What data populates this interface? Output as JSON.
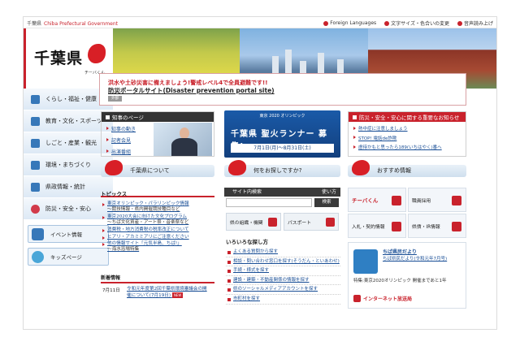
{
  "topbar": {
    "prefecture": "千葉県",
    "english": "Chiba Prefectural Government",
    "links": [
      "Foreign Languages",
      "文字サイズ・色合いの変更",
      "音声読み上げ"
    ]
  },
  "logo": {
    "kanji": "千葉県",
    "mascot": "チーバくん"
  },
  "nav": {
    "items": [
      "くらし・福祉・健康",
      "教育・文化・スポーツ",
      "しごと・産業・観光",
      "環境・まちづくり",
      "県政情報・統計",
      "防災・安全・安心"
    ],
    "buttons": [
      "イベント情報",
      "キッズページ"
    ]
  },
  "alert": {
    "line1": "洪水や土砂災害に備えましょう!警戒レベル4で全員避難です!!",
    "line2": "防災ポータルサイト(Disaster prevention portal site)",
    "tag": "外部"
  },
  "governor": {
    "header": "知事のページ",
    "links": [
      "知事の動き",
      "記者会見",
      "出演番組"
    ]
  },
  "olympic": {
    "top": "東京 2020 オリンピック",
    "main": "千葉県 聖火ランナー 募集!",
    "dates": "7月1日(月)〜8月31日(土)"
  },
  "safety": {
    "header": "防災・安全・安心に関する重要なお知らせ",
    "links": [
      "熱中症に注意しましょう",
      "STOP! 電話de詐欺",
      "虐待かもと思ったら189(いちはやく)番へ"
    ]
  },
  "sections": {
    "about": "千葉県について",
    "search": "何をお探しですか?",
    "recommend": "おすすめ情報"
  },
  "topics": {
    "header": "トピックス",
    "items": [
      {
        "title": "東京オリンピック・パラリンピック情報",
        "sub": "〜競技情報・県内開催競技種目など"
      },
      {
        "title": "東京2020大会に向けた文化プログラム",
        "sub": "〜ちば文化資産・アート祭・音楽祭など"
      },
      {
        "title": "消費税・地方消費税の税率改正について",
        "sub": ""
      },
      {
        "title": "ヒアリ・アカミミアリにご注意ください",
        "sub": ""
      },
      {
        "title": "他の情報サイト「元気半島、ちば!」",
        "sub": "〜海水浴場特集"
      }
    ]
  },
  "news": {
    "header": "新着情報",
    "date": "7月11日",
    "text": "令和元年度第2回千葉県環境審議会の開催について(7月19日)",
    "badge": "NEW"
  },
  "search": {
    "header": "サイト内検索",
    "help": "使い方",
    "button": "検索",
    "map_buttons": [
      "県の組織・機関",
      "パスポート"
    ]
  },
  "iro": {
    "header": "いろいろな探し方",
    "items": [
      "よくある質問から探す",
      "相談・問い合わせ窓口を探す(そうだん・といあわせ)",
      "手続・様式を探す",
      "建設・建築・不動産関係の情報を探す",
      "県のソーシャルメディアアカウントを探す",
      "市町村を探す"
    ]
  },
  "recommend": {
    "items": [
      "チーバくん",
      "職員採用",
      "入札・契約情報",
      "県債・IR情報"
    ]
  },
  "koho": {
    "title": "ちば県民だより",
    "sub": "ちば県民だより(令和元年7月号)",
    "note": "特集:東京2020オリンピック 開催まであと1年",
    "radio": "インターネット放送局"
  }
}
